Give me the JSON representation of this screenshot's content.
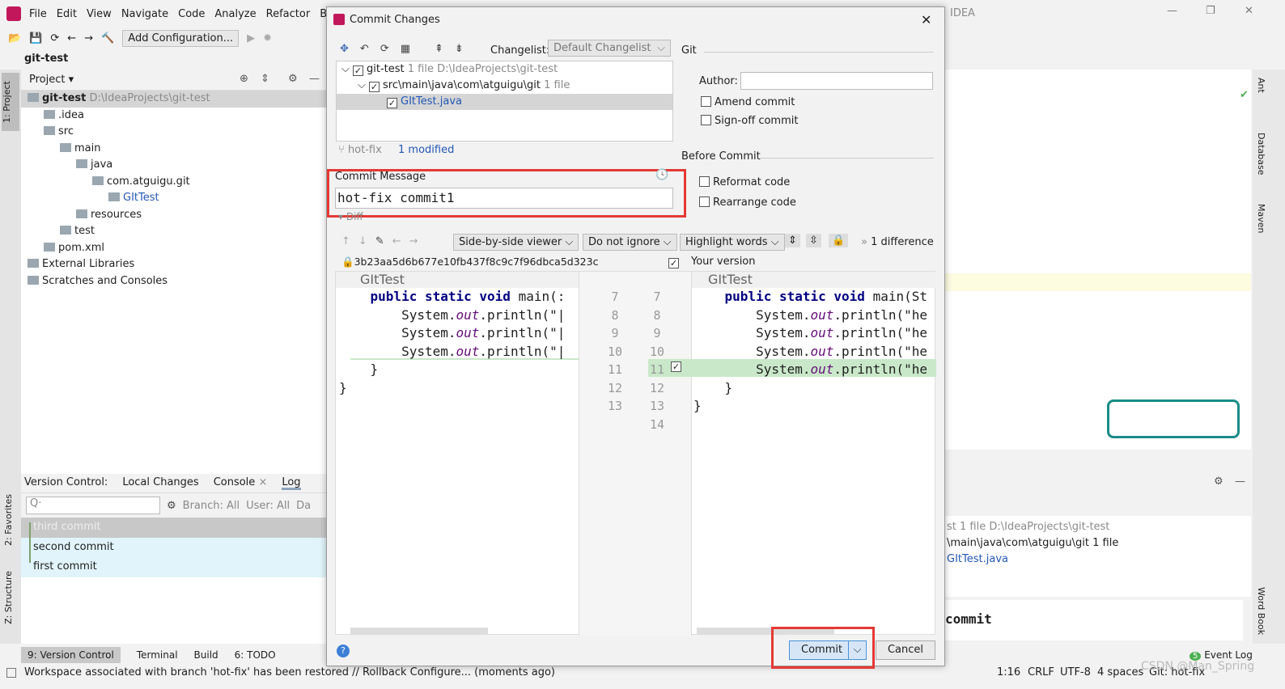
{
  "menu": [
    "File",
    "Edit",
    "View",
    "Navigate",
    "Code",
    "Analyze",
    "Refactor",
    "Buil"
  ],
  "window_title_fragment": "IDEA",
  "toolbar": {
    "run_config": "Add Configuration..."
  },
  "project": {
    "breadcrumb": "git-test",
    "panel_title": "Project",
    "tree": [
      {
        "label": "git-test",
        "extra": "D:\\IdeaProjects\\git-test",
        "depth": 0,
        "bold": true
      },
      {
        "label": ".idea",
        "depth": 1
      },
      {
        "label": "src",
        "depth": 1
      },
      {
        "label": "main",
        "depth": 2
      },
      {
        "label": "java",
        "depth": 3
      },
      {
        "label": "com.atguigu.git",
        "depth": 4
      },
      {
        "label": "GItTest",
        "depth": 5,
        "blue": true
      },
      {
        "label": "resources",
        "depth": 3
      },
      {
        "label": "test",
        "depth": 2
      },
      {
        "label": "pom.xml",
        "depth": 1
      },
      {
        "label": "External Libraries",
        "depth": 0
      },
      {
        "label": "Scratches and Consoles",
        "depth": 0
      }
    ]
  },
  "left_strip": {
    "project": "1: Project",
    "favorites": "2: Favorites",
    "structure": "Z: Structure"
  },
  "right_strip": {
    "ant": "Ant",
    "database": "Database",
    "maven": "Maven",
    "wordbook": "Word Book"
  },
  "vc": {
    "label": "Version Control:",
    "tabs": [
      "Local Changes",
      "Console",
      "Log"
    ],
    "active": "Log",
    "branch": "Branch: All",
    "user": "User: All",
    "date": "Da",
    "commits": [
      "third commit",
      "second commit",
      "first commit"
    ],
    "right_tree": [
      "st 1 file  D:\\IdeaProjects\\git-test",
      "\\main\\java\\com\\atguigu\\git  1 file",
      "GItTest.java"
    ],
    "right_msg": "commit"
  },
  "bottom_tabs": [
    "9: Version Control",
    "Terminal",
    "Build",
    "6: TODO"
  ],
  "event_log": {
    "count": "5",
    "label": "Event Log"
  },
  "status": {
    "message": "Workspace associated with branch 'hot-fix' has been restored // Rollback  Configure... (moments ago)",
    "position": "1:16",
    "line_sep": "CRLF",
    "encoding": "UTF-8",
    "indent": "4 spaces",
    "git": "Git: hot-fix",
    "watermark": "CSDN @Man_Spring"
  },
  "dialog": {
    "title": "Commit Changes",
    "changelist_label": "Changelist:",
    "changelist": "Default Changelist",
    "files": [
      {
        "label": "git-test",
        "extra": "1 file  D:\\IdeaProjects\\git-test"
      },
      {
        "label": "src\\main\\java\\com\\atguigu\\git",
        "extra": "1 file"
      },
      {
        "label": "GItTest.java"
      }
    ],
    "branch": "hot-fix",
    "modified": "1 modified",
    "git_section": "Git",
    "author_label": "Author:",
    "author_value": "",
    "amend": "Amend commit",
    "signoff": "Sign-off commit",
    "before_commit": "Before Commit",
    "reformat": "Reformat code",
    "rearrange": "Rearrange code",
    "commit_message_label": "Commit Message",
    "commit_message": "hot-fix commit1",
    "diff_label": "Diff",
    "viewer": "Side-by-side viewer",
    "ignore": "Do not ignore",
    "highlight": "Highlight words",
    "differences": "1 difference",
    "left_hash": "3b23aa5d6b677e10fb437f8c9c7f96dbca5d323c",
    "right_version": "Your version",
    "file_tab": "GItTest",
    "left_lines": [
      "    public static void main(:",
      "        System.out.println(\"|",
      "        System.out.println(\"|",
      "        System.out.println(\"|",
      "    }",
      "}"
    ],
    "right_lines": [
      "    public static void main(St",
      "        System.out.println(\"he",
      "        System.out.println(\"he",
      "        System.out.println(\"he",
      "        System.out.println(\"he",
      "    }",
      "}"
    ],
    "left_nums": [
      "7",
      "8",
      "9",
      "10",
      "11",
      "12",
      "13"
    ],
    "right_nums": [
      "7",
      "8",
      "9",
      "10",
      "11",
      "12",
      "13",
      "14"
    ],
    "commit_button": "Commit",
    "cancel_button": "Cancel"
  },
  "colors": {
    "highlight_red": "#e53935",
    "added_green": "#c9e8c9",
    "selection": "#d5d5d5",
    "log_row": "#e1f4fb"
  }
}
